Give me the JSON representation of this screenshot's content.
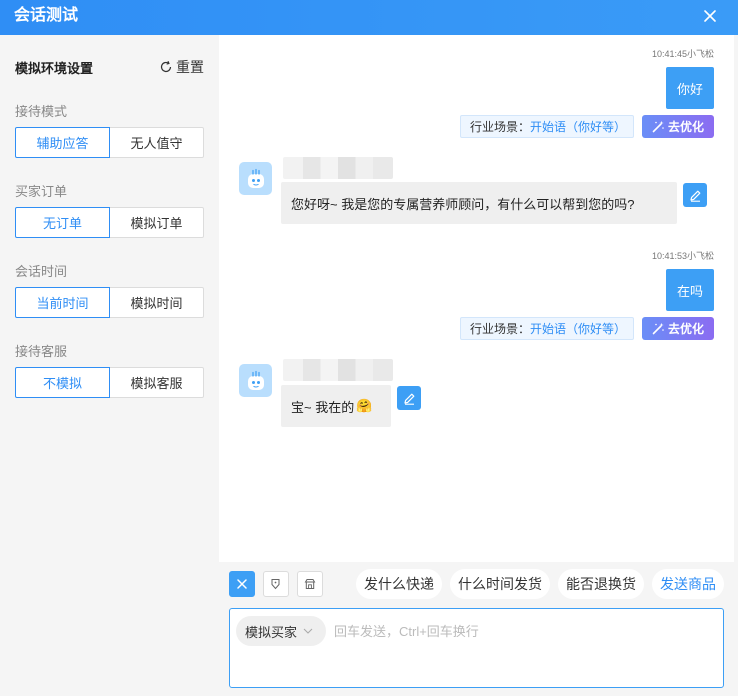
{
  "header": {
    "title": "会话测试"
  },
  "sidebar": {
    "title": "模拟环境设置",
    "reset_label": "重置",
    "groups": [
      {
        "label": "接待模式",
        "options": [
          "辅助应答",
          "无人值守"
        ],
        "selected": "辅助应答"
      },
      {
        "label": "买家订单",
        "options": [
          "无订单",
          "模拟订单"
        ],
        "selected": "无订单"
      },
      {
        "label": "会话时间",
        "options": [
          "当前时间",
          "模拟时间"
        ],
        "selected": "当前时间"
      },
      {
        "label": "接待客服",
        "options": [
          "不模拟",
          "模拟客服"
        ],
        "selected": "不模拟"
      }
    ]
  },
  "chat": {
    "messages": [
      {
        "type": "outgoing",
        "meta": "10:41:45小飞松",
        "text": "你好",
        "scene_label": "行业场景：",
        "scene_value": "开始语（你好等）",
        "optimize_label": "去优化"
      },
      {
        "type": "incoming",
        "text": "您好呀~ 我是您的专属营养师顾问，有什么可以帮到您的吗?"
      },
      {
        "type": "outgoing",
        "meta": "10:41:53小飞松",
        "text": "在吗",
        "scene_label": "行业场景：",
        "scene_value": "开始语（你好等）",
        "optimize_label": "去优化"
      },
      {
        "type": "incoming",
        "text": "宝~ 我在的",
        "emoji": "🤗"
      }
    ]
  },
  "toolbar": {
    "quick_replies": [
      "发什么快递",
      "什么时间发货",
      "能否退换货"
    ],
    "send_product": "发送商品"
  },
  "input": {
    "role": "模拟买家",
    "placeholder": "回车发送，Ctrl+回车换行",
    "value": ""
  },
  "colors": {
    "primary": "#2f8ef5",
    "bubble_out": "#3d9ff5",
    "optimize_gradient": [
      "#6a8ef7",
      "#8b6cf1"
    ]
  },
  "icons": [
    "close-icon",
    "refresh-icon",
    "robot-icon",
    "pencil-icon",
    "magic-wand-icon",
    "cross-icon",
    "tag-icon",
    "store-icon",
    "chevron-down-icon"
  ]
}
